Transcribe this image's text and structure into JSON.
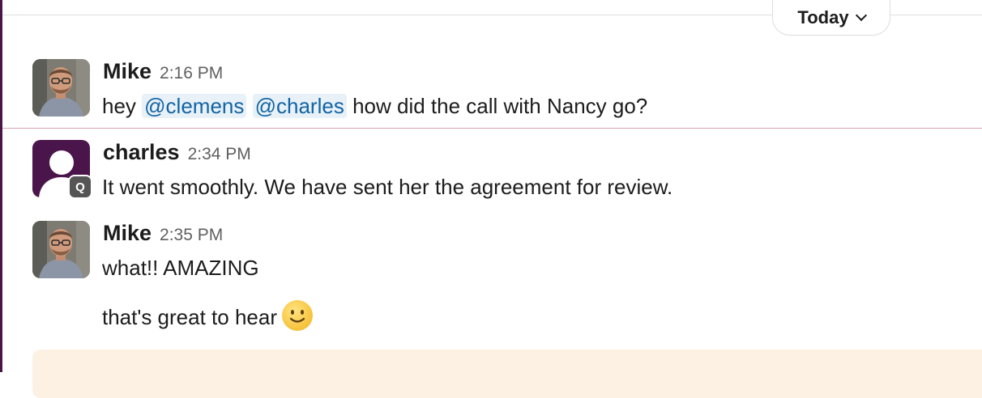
{
  "date_divider": {
    "label": "Today"
  },
  "messages": [
    {
      "author": "Mike",
      "time": "2:16 PM",
      "text_prefix": "hey",
      "mentions": [
        "@clemens",
        "@charles"
      ],
      "text_suffix": "how did the call with Nancy go?"
    },
    {
      "author": "charles",
      "time": "2:34 PM",
      "badge": "Q",
      "text": "It went smoothly. We have sent her the agreement for review."
    },
    {
      "author": "Mike",
      "time": "2:35 PM",
      "text": "what!! AMAZING",
      "followup": "that's great to hear"
    }
  ],
  "colors": {
    "accent": "#4a154b",
    "mention_text": "#1264a3",
    "mention_bg": "#e8f1f8",
    "new_messages_line": "#d9a0b5",
    "composer_bg": "#fdf1e3"
  },
  "icons": {
    "date_menu": "chevron-down-icon",
    "emoji": "slightly-smiling-face-emoji"
  }
}
